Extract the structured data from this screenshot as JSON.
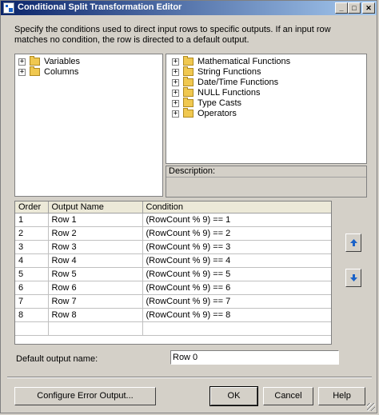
{
  "window": {
    "title": "Conditional Split Transformation Editor",
    "minimize_glyph": "_",
    "maximize_glyph": "□",
    "close_glyph": "✕"
  },
  "description": "Specify the conditions used to direct input rows to specific outputs. If an input row matches no condition, the row is directed to a default output.",
  "left_tree": [
    {
      "label": "Variables",
      "expander": "+"
    },
    {
      "label": "Columns",
      "expander": "+"
    }
  ],
  "right_tree": [
    {
      "label": "Mathematical Functions",
      "expander": "+"
    },
    {
      "label": "String Functions",
      "expander": "+"
    },
    {
      "label": "Date/Time Functions",
      "expander": "+"
    },
    {
      "label": "NULL Functions",
      "expander": "+"
    },
    {
      "label": "Type Casts",
      "expander": "+"
    },
    {
      "label": "Operators",
      "expander": "+"
    }
  ],
  "description_panel": {
    "label": "Description:"
  },
  "grid": {
    "headers": [
      "Order",
      "Output Name",
      "Condition"
    ],
    "rows": [
      {
        "order": "1",
        "name": "Row 1",
        "condition": "(RowCount % 9) == 1"
      },
      {
        "order": "2",
        "name": "Row 2",
        "condition": "(RowCount % 9) == 2"
      },
      {
        "order": "3",
        "name": "Row 3",
        "condition": "(RowCount % 9) == 3"
      },
      {
        "order": "4",
        "name": "Row 4",
        "condition": "(RowCount % 9) == 4"
      },
      {
        "order": "5",
        "name": "Row 5",
        "condition": "(RowCount % 9) == 5"
      },
      {
        "order": "6",
        "name": "Row 6",
        "condition": "(RowCount % 9) == 6"
      },
      {
        "order": "7",
        "name": "Row 7",
        "condition": "(RowCount % 9) == 7"
      },
      {
        "order": "8",
        "name": "Row 8",
        "condition": "(RowCount % 9) == 8"
      },
      {
        "order": "",
        "name": "",
        "condition": ""
      }
    ]
  },
  "default_output": {
    "label": "Default output name:",
    "value": "Row 0"
  },
  "buttons": {
    "configure_error": "Configure Error Output...",
    "ok": "OK",
    "cancel": "Cancel",
    "help": "Help"
  },
  "icons": {
    "move_up": "arrow-up-icon",
    "move_down": "arrow-down-icon",
    "folder": "folder-icon"
  },
  "colors": {
    "title_start": "#0a246a",
    "title_end": "#a6caf0",
    "face": "#d4d0c8",
    "arrow": "#1a62c8"
  }
}
